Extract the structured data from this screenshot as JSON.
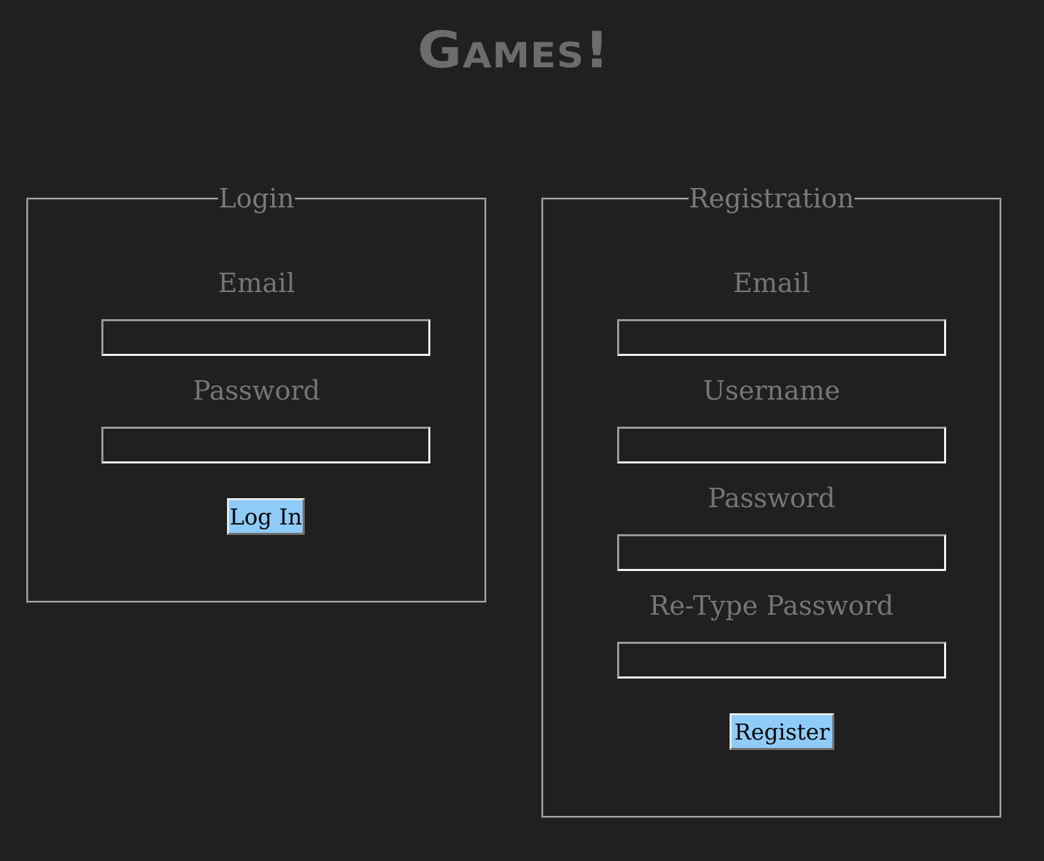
{
  "page": {
    "title": "Games!"
  },
  "login": {
    "legend": "Login",
    "email_label": "Email",
    "email_value": "",
    "password_label": "Password",
    "password_value": "",
    "submit_label": "Log In"
  },
  "registration": {
    "legend": "Registration",
    "email_label": "Email",
    "email_value": "",
    "username_label": "Username",
    "username_value": "",
    "password_label": "Password",
    "password_value": "",
    "retype_label": "Re-Type Password",
    "retype_value": "",
    "submit_label": "Register"
  },
  "colors": {
    "background": "#202020",
    "text": "#777777",
    "button": "#8fcbf7"
  }
}
